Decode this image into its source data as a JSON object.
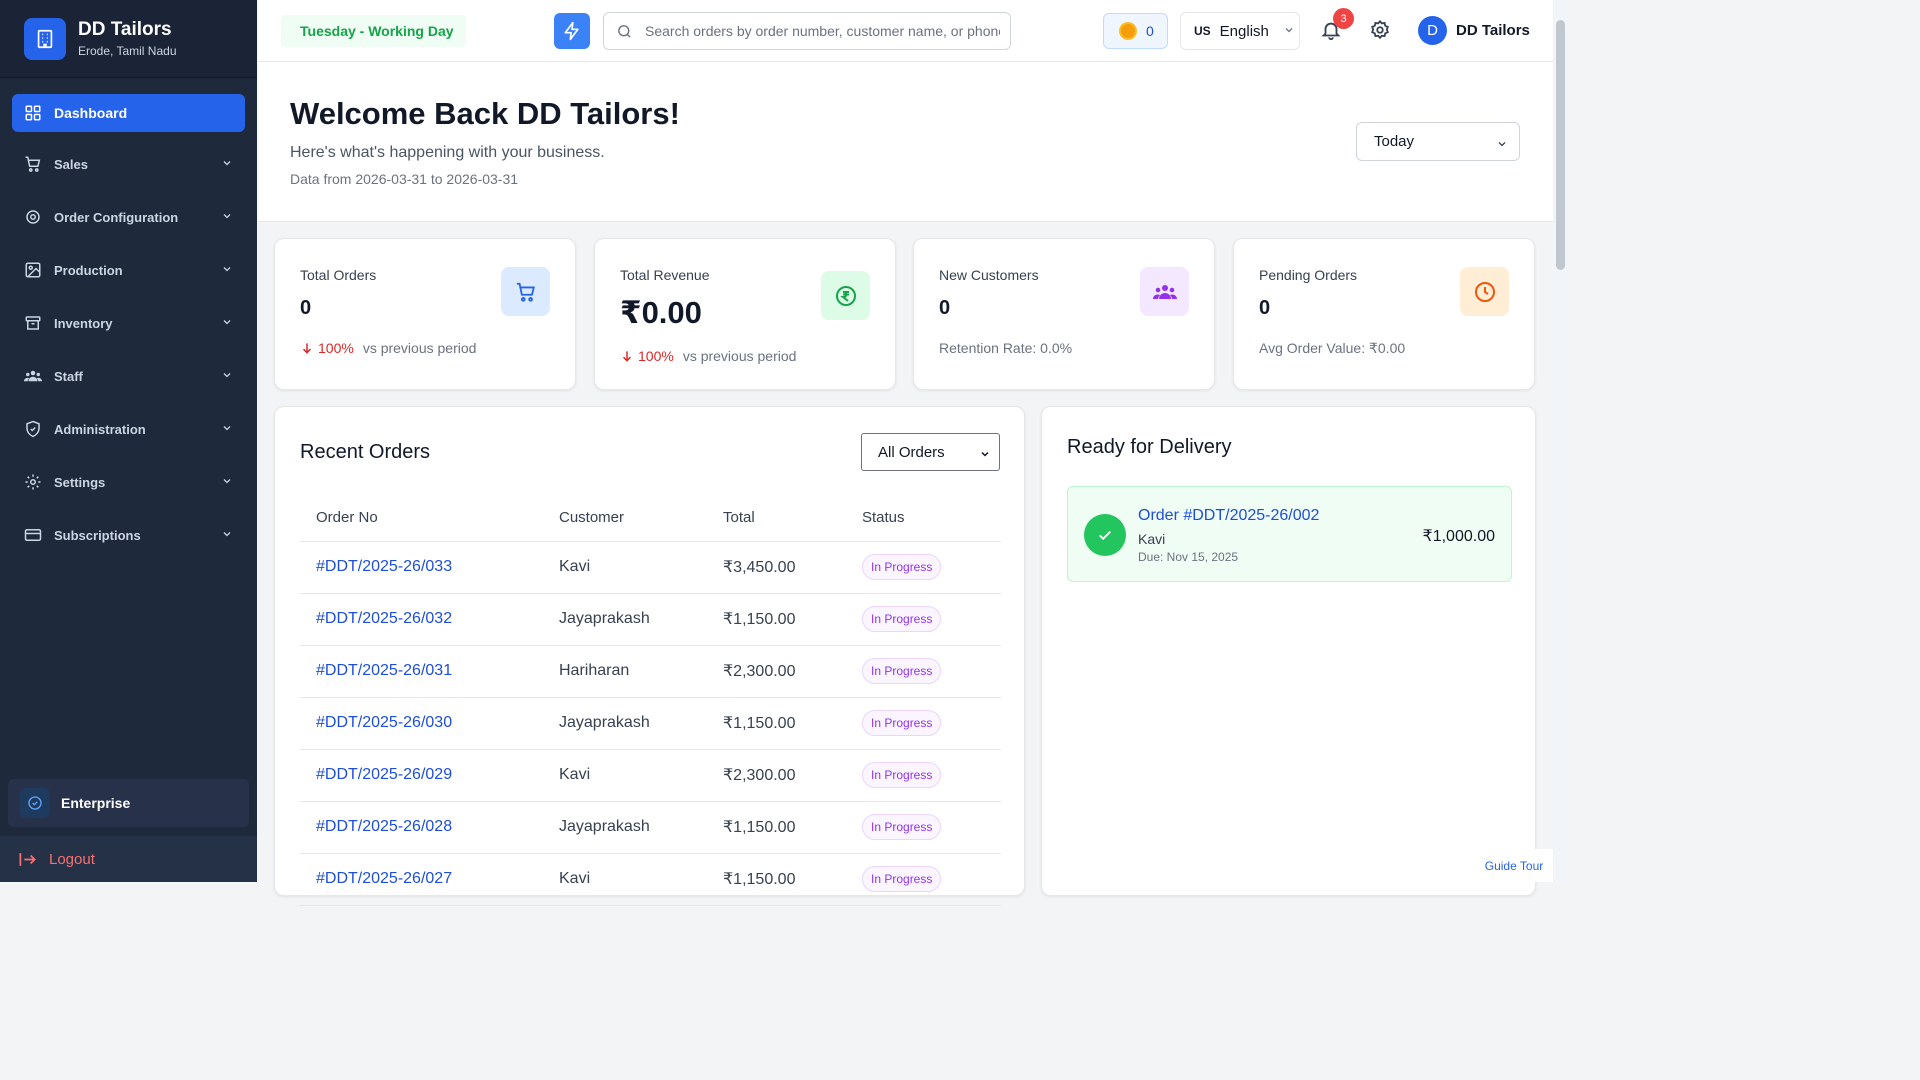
{
  "brand": {
    "name": "DD Tailors",
    "location": "Erode, Tamil Nadu"
  },
  "sidebar": {
    "items": [
      {
        "label": "Dashboard",
        "icon": "grid-icon",
        "active": true
      },
      {
        "label": "Sales",
        "icon": "cart-icon"
      },
      {
        "label": "Order Configuration",
        "icon": "cog-icon"
      },
      {
        "label": "Production",
        "icon": "image-icon"
      },
      {
        "label": "Inventory",
        "icon": "archive-icon"
      },
      {
        "label": "Staff",
        "icon": "users-icon"
      },
      {
        "label": "Administration",
        "icon": "shield-icon"
      },
      {
        "label": "Settings",
        "icon": "gear-icon"
      },
      {
        "label": "Subscriptions",
        "icon": "card-icon"
      }
    ],
    "plan": "Enterprise",
    "logout": "Logout"
  },
  "header": {
    "day_status": "Tuesday - Working Day",
    "search_placeholder": "Search orders by order number, customer name, or phone",
    "coins": "0",
    "language_flag": "US",
    "language": "English",
    "notifications": "3",
    "user_initial": "D",
    "user_name": "DD Tailors"
  },
  "welcome": {
    "title": "Welcome Back DD Tailors!",
    "subtitle": "Here's what's happening with your business.",
    "range": "Data from 2026-03-31 to 2026-03-31",
    "period": "Today"
  },
  "stats": {
    "total_orders": {
      "label": "Total Orders",
      "value": "0",
      "pct": "100%",
      "trend_text": "vs previous period"
    },
    "total_revenue": {
      "label": "Total Revenue",
      "value": "₹0.00",
      "pct": "100%",
      "trend_text": "vs previous period"
    },
    "new_customers": {
      "label": "New Customers",
      "value": "0",
      "meta": "Retention Rate: 0.0%"
    },
    "pending_orders": {
      "label": "Pending Orders",
      "value": "0",
      "meta": "Avg Order Value: ₹0.00"
    }
  },
  "recent_orders": {
    "title": "Recent Orders",
    "filter": "All Orders",
    "columns": [
      "Order No",
      "Customer",
      "Total",
      "Status"
    ],
    "rows": [
      {
        "order": "#DDT/2025-26/033",
        "customer": "Kavi",
        "total": "₹3,450.00",
        "status": "In Progress"
      },
      {
        "order": "#DDT/2025-26/032",
        "customer": "Jayaprakash",
        "total": "₹1,150.00",
        "status": "In Progress"
      },
      {
        "order": "#DDT/2025-26/031",
        "customer": "Hariharan",
        "total": "₹2,300.00",
        "status": "In Progress"
      },
      {
        "order": "#DDT/2025-26/030",
        "customer": "Jayaprakash",
        "total": "₹1,150.00",
        "status": "In Progress"
      },
      {
        "order": "#DDT/2025-26/029",
        "customer": "Kavi",
        "total": "₹2,300.00",
        "status": "In Progress"
      },
      {
        "order": "#DDT/2025-26/028",
        "customer": "Jayaprakash",
        "total": "₹1,150.00",
        "status": "In Progress"
      },
      {
        "order": "#DDT/2025-26/027",
        "customer": "Kavi",
        "total": "₹1,150.00",
        "status": "In Progress"
      }
    ]
  },
  "delivery": {
    "title": "Ready for Delivery",
    "items": [
      {
        "order": "Order #DDT/2025-26/002",
        "customer": "Kavi",
        "due": "Due: Nov 15, 2025",
        "amount": "₹1,000.00"
      }
    ]
  },
  "guide_tour": "Guide Tour",
  "colors": {
    "sidebar_bg": "#1e293b",
    "accent": "#2563eb",
    "success": "#22c55e",
    "danger": "#ef4444",
    "status_purple": "#9333ea"
  }
}
